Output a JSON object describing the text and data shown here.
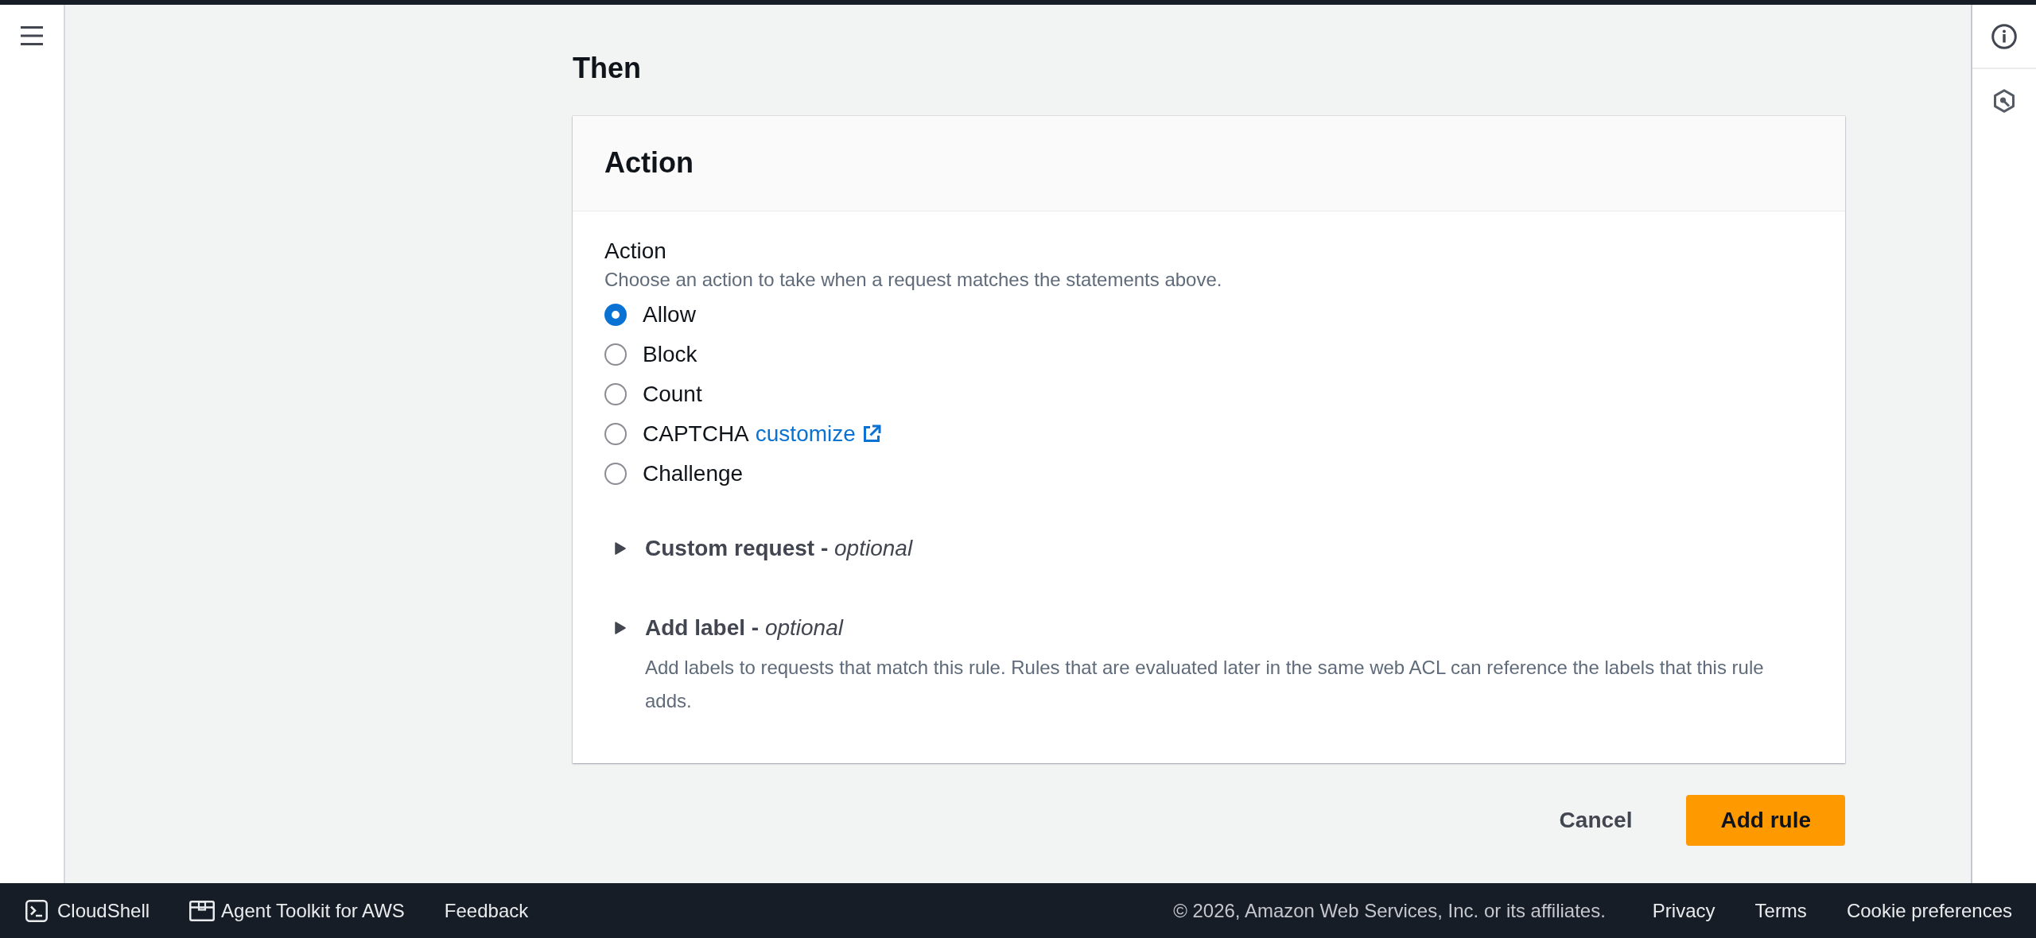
{
  "section": {
    "title": "Then"
  },
  "card": {
    "title": "Action",
    "field": {
      "label": "Action",
      "description": "Choose an action to take when a request matches the statements above.",
      "options": [
        {
          "label": "Allow",
          "selected": true
        },
        {
          "label": "Block",
          "selected": false
        },
        {
          "label": "Count",
          "selected": false
        },
        {
          "label": "CAPTCHA",
          "selected": false,
          "link": "customize"
        },
        {
          "label": "Challenge",
          "selected": false
        }
      ]
    },
    "expanders": [
      {
        "title": "Custom request - *optional*",
        "expanded": false
      },
      {
        "title": "Add label - *optional*",
        "expanded": false,
        "description": "Add labels to requests that match this rule. Rules that are evaluated later in the same web ACL can reference the labels that this rule adds."
      }
    ]
  },
  "actions": [
    {
      "label": "Cancel",
      "kind": "link"
    },
    {
      "label": "Add rule",
      "kind": "primary"
    }
  ],
  "footer": {
    "left": [
      {
        "label": "CloudShell",
        "kind": "terminal"
      },
      {
        "label": "Agent Toolkit for AWS",
        "kind": "window"
      },
      {
        "label": "Feedback",
        "kind": "plain"
      }
    ],
    "copyright": "© 2026, Amazon Web Services, Inc. or its affiliates.",
    "links": [
      "Privacy",
      "Terms",
      "Cookie preferences"
    ]
  }
}
